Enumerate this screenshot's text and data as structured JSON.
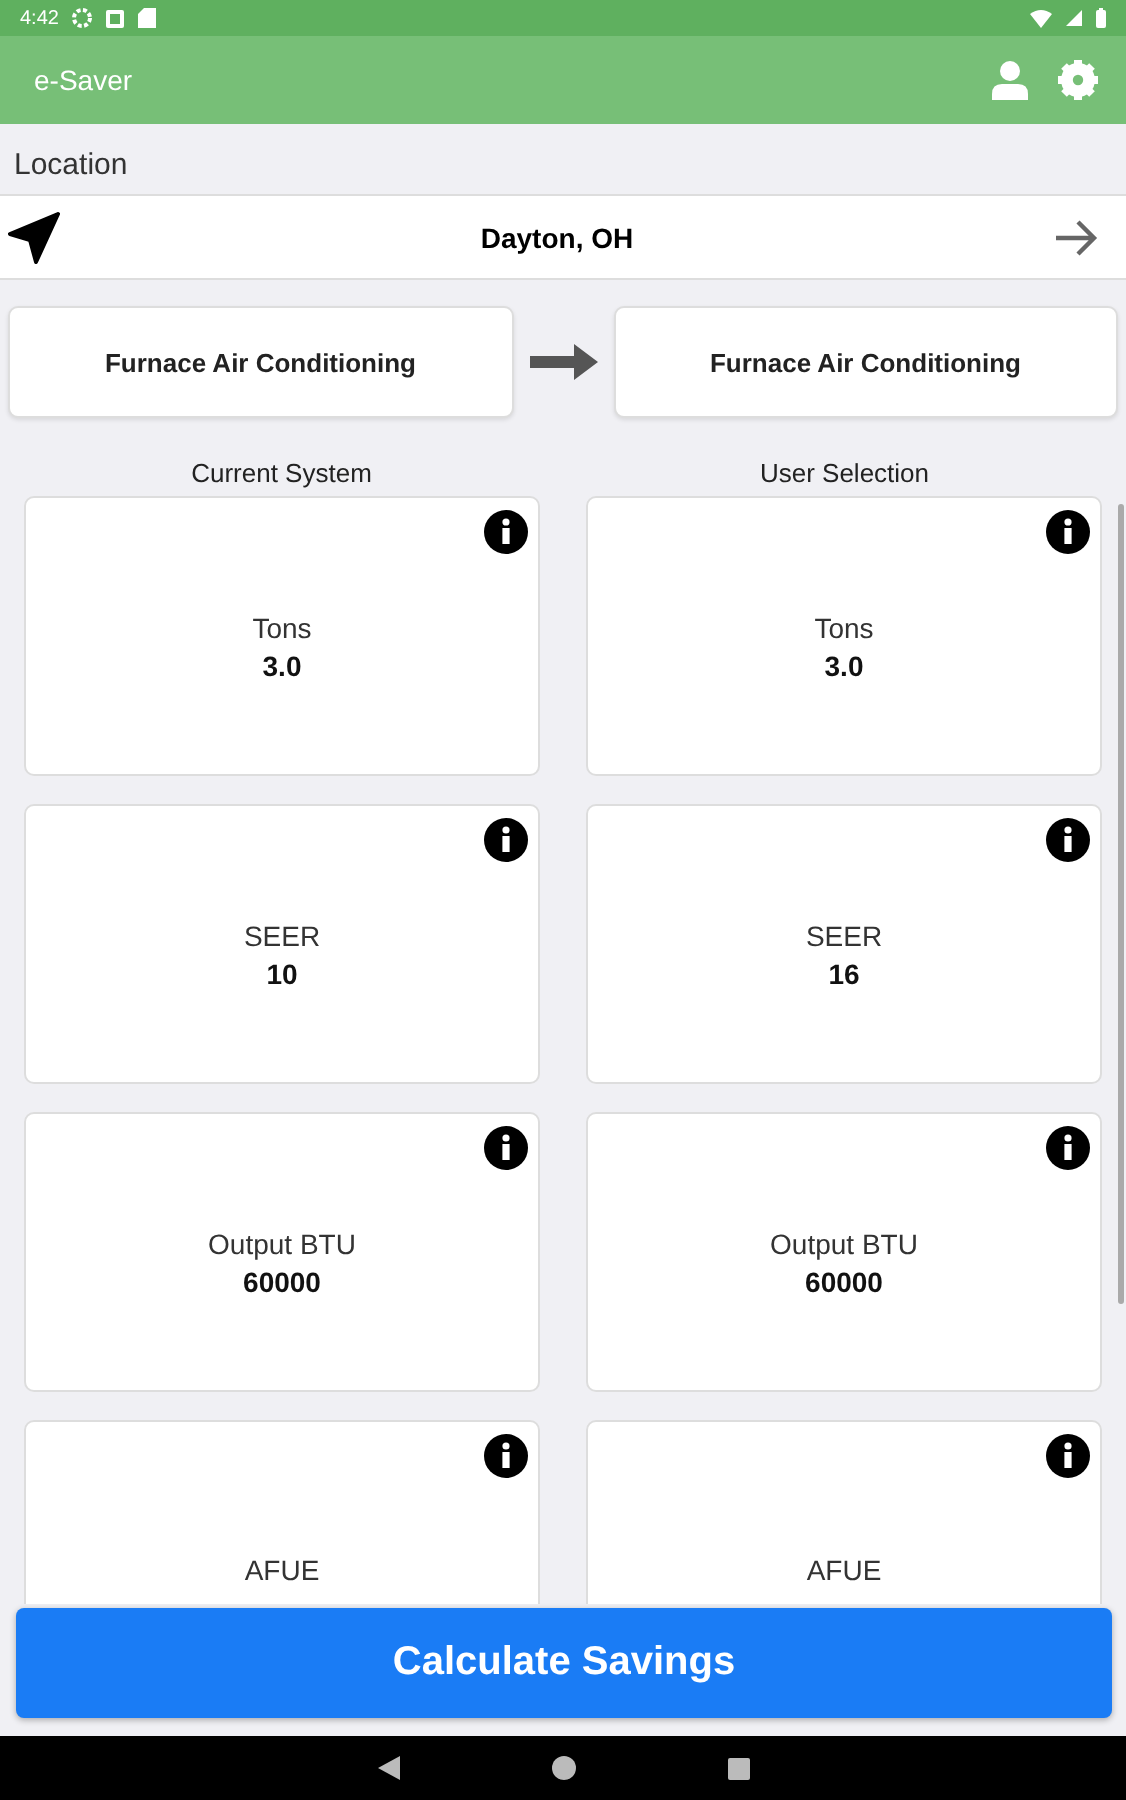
{
  "status_bar": {
    "time": "4:42"
  },
  "app_bar": {
    "title": "e-Saver"
  },
  "location": {
    "label": "Location",
    "value": "Dayton, OH"
  },
  "systems": {
    "current": "Furnace Air Conditioning",
    "selected": "Furnace Air Conditioning"
  },
  "columns": [
    "Current System",
    "User Selection"
  ],
  "rows": [
    {
      "current": {
        "label": "Tons",
        "value": "3.0"
      },
      "selected": {
        "label": "Tons",
        "value": "3.0"
      }
    },
    {
      "current": {
        "label": "SEER",
        "value": "10"
      },
      "selected": {
        "label": "SEER",
        "value": "16"
      }
    },
    {
      "current": {
        "label": "Output BTU",
        "value": "60000"
      },
      "selected": {
        "label": "Output BTU",
        "value": "60000"
      }
    },
    {
      "current": {
        "label": "AFUE"
      },
      "selected": {
        "label": "AFUE"
      }
    }
  ],
  "action": {
    "label": "Calculate Savings"
  }
}
